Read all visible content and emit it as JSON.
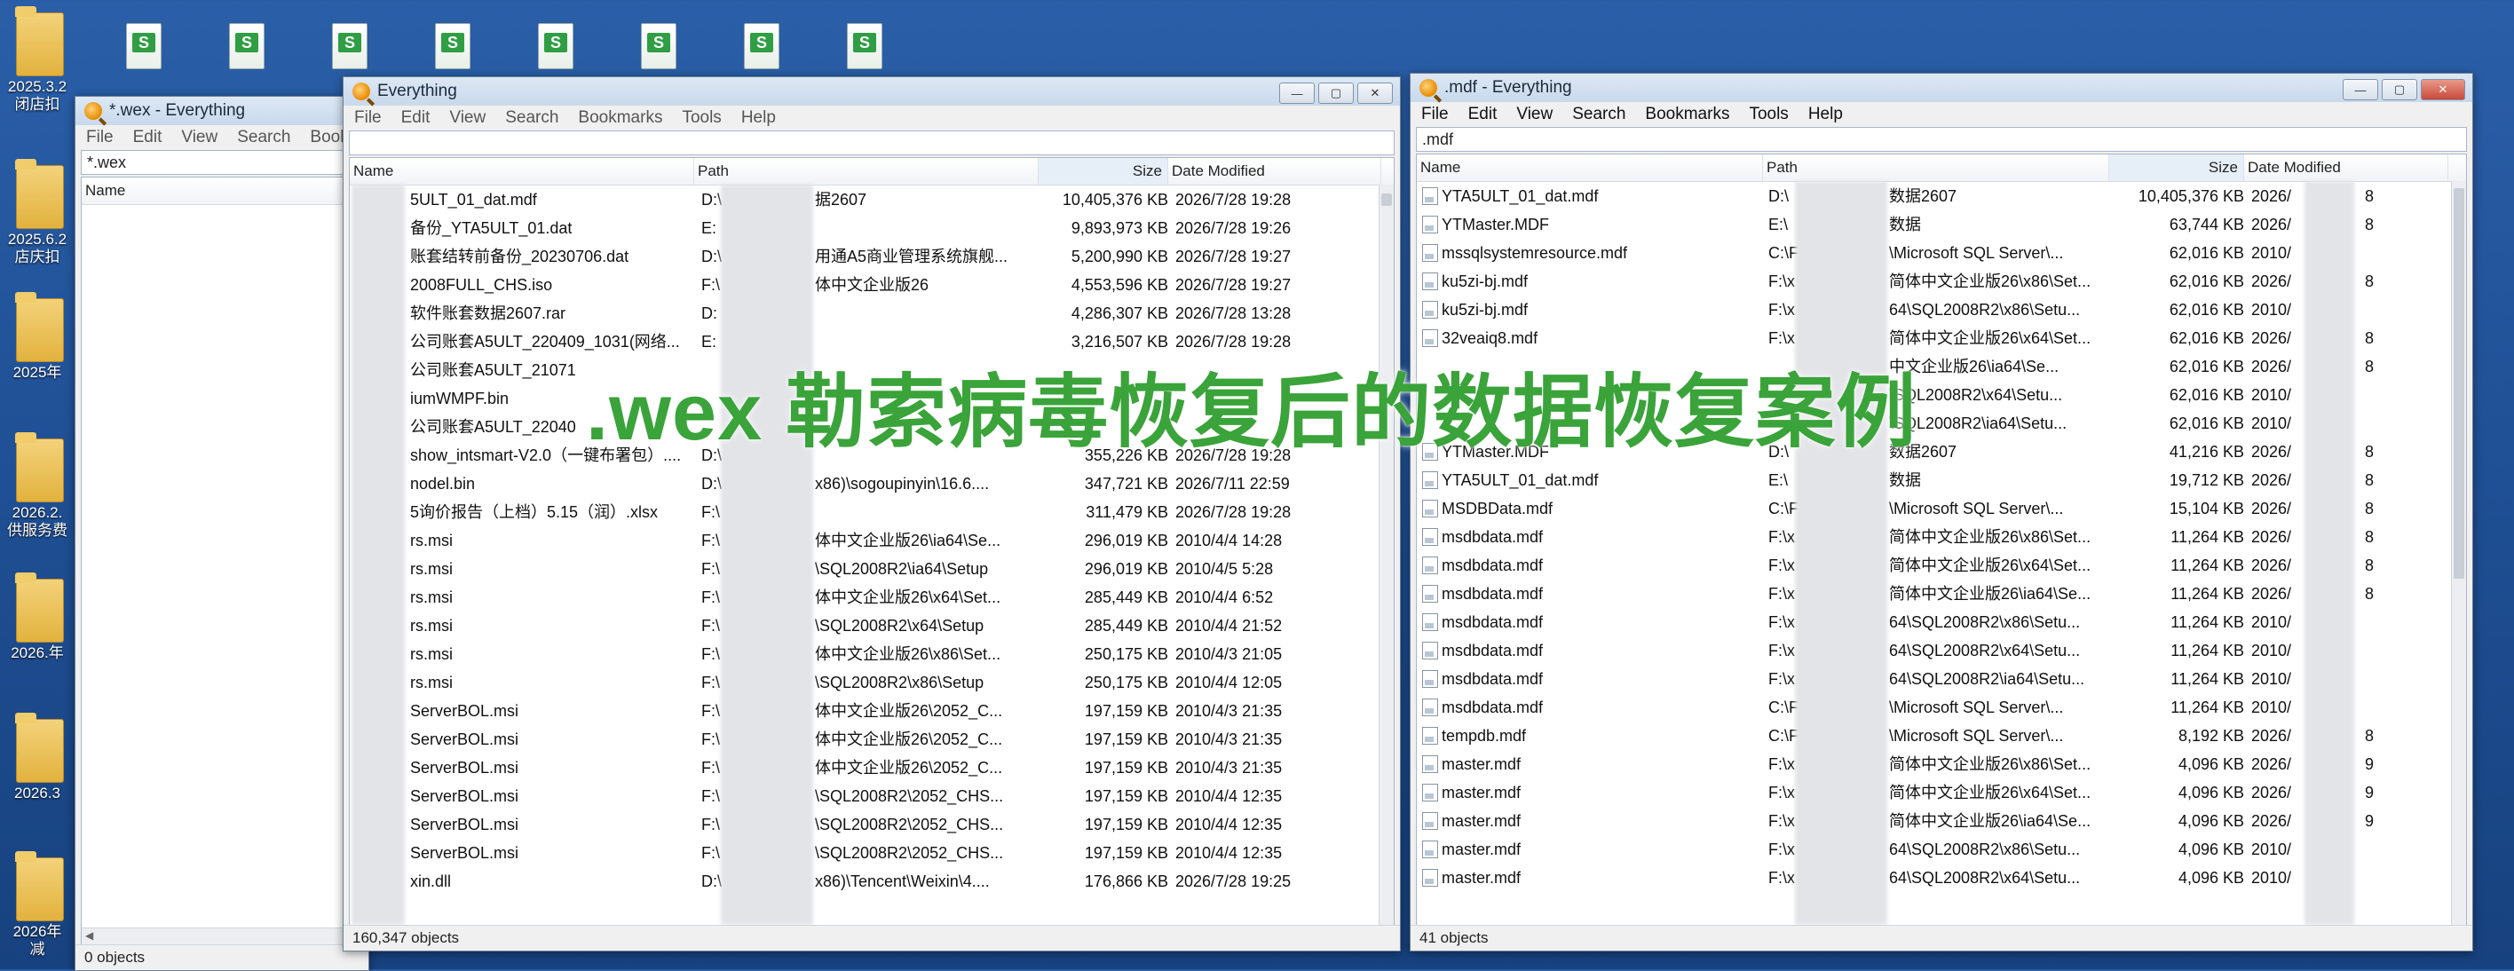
{
  "desktop": {
    "top_icons": [
      "S",
      "S",
      "S",
      "S",
      "S",
      "S",
      "S",
      "S"
    ],
    "folders": [
      {
        "label": "2025.3.2\n闭店扣"
      },
      {
        "label": "2025.6.2\n店庆扣"
      },
      {
        "label": "2025年"
      },
      {
        "label": "2026.2.\n供服务费"
      },
      {
        "label": "2026.年"
      },
      {
        "label": "2026.3"
      },
      {
        "label": "2026年\n减"
      }
    ]
  },
  "overlay": {
    "text": ".wex 勒索病毒恢复后的数据恢复案例"
  },
  "window_left": {
    "title": "*.wex - Everything",
    "menu": [
      "File",
      "Edit",
      "View",
      "Search",
      "Book"
    ],
    "search": "*.wex",
    "col_name": "Name",
    "status": "0 objects"
  },
  "window_mid": {
    "title": "Everything",
    "menu": [
      "File",
      "Edit",
      "View",
      "Search",
      "Bookmarks",
      "Tools",
      "Help"
    ],
    "search": "",
    "columns": {
      "name": "Name",
      "path": "Path",
      "size": "Size",
      "date": "Date Modified"
    },
    "rows": [
      {
        "name": "5ULT_01_dat.mdf",
        "path": "D:\\",
        "path2": "据2607",
        "size": "10,405,376 KB",
        "date": "2026/7/28 19:28"
      },
      {
        "name": "备份_YTA5ULT_01.dat",
        "path": "E:",
        "path2": "",
        "size": "9,893,973 KB",
        "date": "2026/7/28 19:26"
      },
      {
        "name": "账套结转前备份_20230706.dat",
        "path": "D:\\",
        "path2": "用通A5商业管理系统旗舰...",
        "size": "5,200,990 KB",
        "date": "2026/7/28 19:27"
      },
      {
        "name": "2008FULL_CHS.iso",
        "path": "F:\\",
        "path2": "体中文企业版26",
        "size": "4,553,596 KB",
        "date": "2026/7/28 19:27"
      },
      {
        "name": "软件账套数据2607.rar",
        "path": "D:",
        "path2": "",
        "size": "4,286,307 KB",
        "date": "2026/7/28 13:28"
      },
      {
        "name": "公司账套A5ULT_220409_1031(网络...",
        "path": "E:",
        "path2": "",
        "size": "3,216,507 KB",
        "date": "2026/7/28 19:28"
      },
      {
        "name": "公司账套A5ULT_21071",
        "path": "",
        "path2": "",
        "size": "",
        "date": ""
      },
      {
        "name": "iumWMPF.bin",
        "path": "",
        "path2": "",
        "size": "",
        "date": ""
      },
      {
        "name": "公司账套A5ULT_22040",
        "path": "",
        "path2": "",
        "size": "",
        "date": ""
      },
      {
        "name": "show_intsmart-V2.0（一键布署包）....",
        "path": "D:\\",
        "path2": "",
        "size": "355,226 KB",
        "date": "2026/7/28 19:28"
      },
      {
        "name": "nodel.bin",
        "path": "D:\\",
        "path2": "x86)\\sogoupinyin\\16.6....",
        "size": "347,721 KB",
        "date": "2026/7/11 22:59"
      },
      {
        "name": "5询价报告（上档）5.15（润）.xlsx",
        "path": "F:\\",
        "path2": "",
        "size": "311,479 KB",
        "date": "2026/7/28 19:28"
      },
      {
        "name": "rs.msi",
        "path": "F:\\",
        "path2": "体中文企业版26\\ia64\\Se...",
        "size": "296,019 KB",
        "date": "2010/4/4 14:28"
      },
      {
        "name": "rs.msi",
        "path": "F:\\",
        "path2": "\\SQL2008R2\\ia64\\Setup",
        "size": "296,019 KB",
        "date": "2010/4/5 5:28"
      },
      {
        "name": "rs.msi",
        "path": "F:\\",
        "path2": "体中文企业版26\\x64\\Set...",
        "size": "285,449 KB",
        "date": "2010/4/4 6:52"
      },
      {
        "name": "rs.msi",
        "path": "F:\\",
        "path2": "\\SQL2008R2\\x64\\Setup",
        "size": "285,449 KB",
        "date": "2010/4/4 21:52"
      },
      {
        "name": "rs.msi",
        "path": "F:\\",
        "path2": "体中文企业版26\\x86\\Set...",
        "size": "250,175 KB",
        "date": "2010/4/3 21:05"
      },
      {
        "name": "rs.msi",
        "path": "F:\\",
        "path2": "\\SQL2008R2\\x86\\Setup",
        "size": "250,175 KB",
        "date": "2010/4/4 12:05"
      },
      {
        "name": "ServerBOL.msi",
        "path": "F:\\",
        "path2": "体中文企业版26\\2052_C...",
        "size": "197,159 KB",
        "date": "2010/4/3 21:35"
      },
      {
        "name": "ServerBOL.msi",
        "path": "F:\\",
        "path2": "体中文企业版26\\2052_C...",
        "size": "197,159 KB",
        "date": "2010/4/3 21:35"
      },
      {
        "name": "ServerBOL.msi",
        "path": "F:\\",
        "path2": "体中文企业版26\\2052_C...",
        "size": "197,159 KB",
        "date": "2010/4/3 21:35"
      },
      {
        "name": "ServerBOL.msi",
        "path": "F:\\",
        "path2": "\\SQL2008R2\\2052_CHS...",
        "size": "197,159 KB",
        "date": "2010/4/4 12:35"
      },
      {
        "name": "ServerBOL.msi",
        "path": "F:\\",
        "path2": "\\SQL2008R2\\2052_CHS...",
        "size": "197,159 KB",
        "date": "2010/4/4 12:35"
      },
      {
        "name": "ServerBOL.msi",
        "path": "F:\\",
        "path2": "\\SQL2008R2\\2052_CHS...",
        "size": "197,159 KB",
        "date": "2010/4/4 12:35"
      },
      {
        "name": "xin.dll",
        "path": "D:\\",
        "path2": "x86)\\Tencent\\Weixin\\4....",
        "size": "176,866 KB",
        "date": "2026/7/28 19:25"
      }
    ],
    "status": "160,347 objects"
  },
  "window_right": {
    "title": ".mdf - Everything",
    "menu": [
      "File",
      "Edit",
      "View",
      "Search",
      "Bookmarks",
      "Tools",
      "Help"
    ],
    "search": ".mdf",
    "columns": {
      "name": "Name",
      "path": "Path",
      "size": "Size",
      "date": "Date Modified"
    },
    "rows": [
      {
        "name": "YTA5ULT_01_dat.mdf",
        "path": "D:\\",
        "path2": "数据2607",
        "size": "10,405,376 KB",
        "date": "2026/",
        "tail": "8"
      },
      {
        "name": "YTMaster.MDF",
        "path": "E:\\",
        "path2": "数据",
        "size": "63,744 KB",
        "date": "2026/",
        "tail": "8"
      },
      {
        "name": "mssqlsystemresource.mdf",
        "path": "C:\\F",
        "path2": "\\Microsoft SQL Server\\...",
        "size": "62,016 KB",
        "date": "2010/",
        "tail": ""
      },
      {
        "name": "ku5zi-bj.mdf",
        "path": "F:\\x",
        "path2": "简体中文企业版26\\x86\\Set...",
        "size": "62,016 KB",
        "date": "2026/",
        "tail": "8"
      },
      {
        "name": "ku5zi-bj.mdf",
        "path": "F:\\x",
        "path2": "64\\SQL2008R2\\x86\\Setu...",
        "size": "62,016 KB",
        "date": "2010/",
        "tail": ""
      },
      {
        "name": "32veaiq8.mdf",
        "path": "F:\\x",
        "path2": "简体中文企业版26\\x64\\Set...",
        "size": "62,016 KB",
        "date": "2026/",
        "tail": "8"
      },
      {
        "name": "",
        "path": "",
        "path2": "中文企业版26\\ia64\\Se...",
        "size": "62,016 KB",
        "date": "2026/",
        "tail": "8"
      },
      {
        "name": "",
        "path": "",
        "path2": "\\SQL2008R2\\x64\\Setu...",
        "size": "62,016 KB",
        "date": "2010/",
        "tail": ""
      },
      {
        "name": "",
        "path": "",
        "path2": "\\SQL2008R2\\ia64\\Setu...",
        "size": "62,016 KB",
        "date": "2010/",
        "tail": ""
      },
      {
        "name": "YTMaster.MDF",
        "path": "D:\\",
        "path2": "数据2607",
        "size": "41,216 KB",
        "date": "2026/",
        "tail": "8"
      },
      {
        "name": "YTA5ULT_01_dat.mdf",
        "path": "E:\\",
        "path2": "数据",
        "size": "19,712 KB",
        "date": "2026/",
        "tail": "8"
      },
      {
        "name": "MSDBData.mdf",
        "path": "C:\\F",
        "path2": "\\Microsoft SQL Server\\...",
        "size": "15,104 KB",
        "date": "2026/",
        "tail": "8"
      },
      {
        "name": "msdbdata.mdf",
        "path": "F:\\x",
        "path2": "简体中文企业版26\\x86\\Set...",
        "size": "11,264 KB",
        "date": "2026/",
        "tail": "8"
      },
      {
        "name": "msdbdata.mdf",
        "path": "F:\\x",
        "path2": "简体中文企业版26\\x64\\Set...",
        "size": "11,264 KB",
        "date": "2026/",
        "tail": "8"
      },
      {
        "name": "msdbdata.mdf",
        "path": "F:\\x",
        "path2": "简体中文企业版26\\ia64\\Se...",
        "size": "11,264 KB",
        "date": "2026/",
        "tail": "8"
      },
      {
        "name": "msdbdata.mdf",
        "path": "F:\\x",
        "path2": "64\\SQL2008R2\\x86\\Setu...",
        "size": "11,264 KB",
        "date": "2010/",
        "tail": ""
      },
      {
        "name": "msdbdata.mdf",
        "path": "F:\\x",
        "path2": "64\\SQL2008R2\\x64\\Setu...",
        "size": "11,264 KB",
        "date": "2010/",
        "tail": ""
      },
      {
        "name": "msdbdata.mdf",
        "path": "F:\\x",
        "path2": "64\\SQL2008R2\\ia64\\Setu...",
        "size": "11,264 KB",
        "date": "2010/",
        "tail": ""
      },
      {
        "name": "msdbdata.mdf",
        "path": "C:\\F",
        "path2": "\\Microsoft SQL Server\\...",
        "size": "11,264 KB",
        "date": "2010/",
        "tail": ""
      },
      {
        "name": "tempdb.mdf",
        "path": "C:\\F",
        "path2": "\\Microsoft SQL Server\\...",
        "size": "8,192 KB",
        "date": "2026/",
        "tail": "8"
      },
      {
        "name": "master.mdf",
        "path": "F:\\x",
        "path2": "简体中文企业版26\\x86\\Set...",
        "size": "4,096 KB",
        "date": "2026/",
        "tail": "9"
      },
      {
        "name": "master.mdf",
        "path": "F:\\x",
        "path2": "简体中文企业版26\\x64\\Set...",
        "size": "4,096 KB",
        "date": "2026/",
        "tail": "9"
      },
      {
        "name": "master.mdf",
        "path": "F:\\x",
        "path2": "简体中文企业版26\\ia64\\Se...",
        "size": "4,096 KB",
        "date": "2026/",
        "tail": "9"
      },
      {
        "name": "master.mdf",
        "path": "F:\\x",
        "path2": "64\\SQL2008R2\\x86\\Setu...",
        "size": "4,096 KB",
        "date": "2010/",
        "tail": ""
      },
      {
        "name": "master.mdf",
        "path": "F:\\x",
        "path2": "64\\SQL2008R2\\x64\\Setu...",
        "size": "4,096 KB",
        "date": "2010/",
        "tail": ""
      }
    ],
    "status": "41 objects"
  }
}
